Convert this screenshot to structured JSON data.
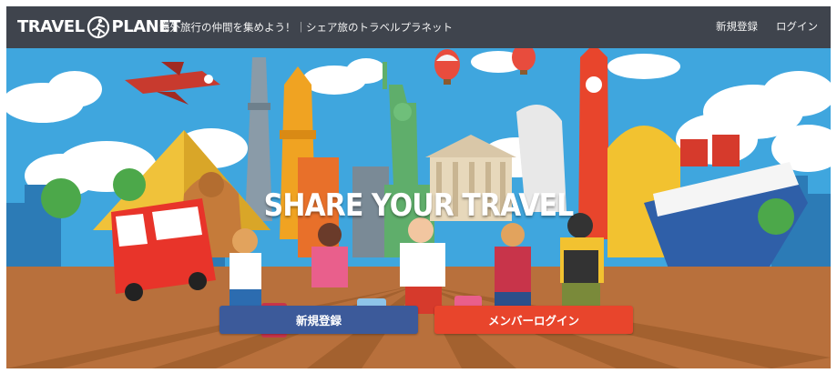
{
  "header": {
    "logo_left": "TRAVEL",
    "logo_right": "PLANET",
    "tagline": "海外旅行の仲間を集めよう！｜シェア旅のトラベルプラネット",
    "nav": {
      "register_label": "新規登録",
      "login_label": "ログイン"
    }
  },
  "hero": {
    "title": "SHARE YOUR TRAVEL",
    "register_button": "新規登録",
    "member_login_button": "メンバーログイン"
  },
  "colors": {
    "header_bg": "#3f444d",
    "register_button": "#3c5a9a",
    "login_button": "#e8452c",
    "sky": "#3fa6de",
    "ground": "#b8703c"
  }
}
